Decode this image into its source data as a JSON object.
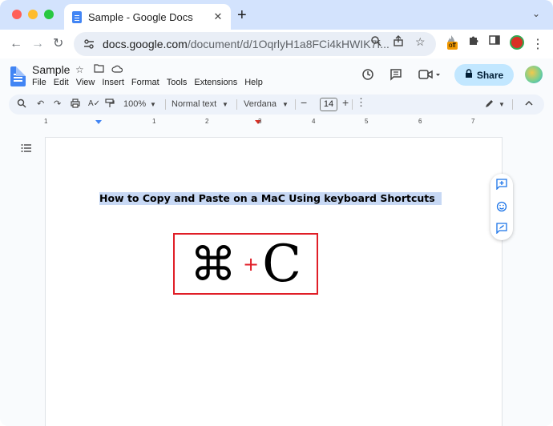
{
  "browser": {
    "tab": {
      "title": "Sample - Google Docs",
      "close": "✕"
    },
    "new_tab": "+",
    "tab_menu": "⌄",
    "nav": {
      "back": "←",
      "forward": "→",
      "reload": "↻"
    },
    "url": {
      "host": "docs.google.com",
      "path": "/document/d/1OqrlyH1a8FCi4kHWIK7f..."
    },
    "extension_badge": "off",
    "menu": "⋮"
  },
  "docs": {
    "title": "Sample",
    "menu": [
      "File",
      "Edit",
      "View",
      "Insert",
      "Format",
      "Tools",
      "Extensions",
      "Help"
    ],
    "share_label": "Share"
  },
  "format_toolbar": {
    "zoom": "100%",
    "style": "Normal text",
    "font": "Verdana",
    "font_size": "14",
    "minus": "−",
    "plus": "+"
  },
  "ruler": [
    "1",
    "1",
    "2",
    "3",
    "4",
    "5",
    "6",
    "7"
  ],
  "document": {
    "heading": "How to Copy and Paste on a MaC Using keyboard Shortcuts",
    "shortcut": {
      "modifier": "⌘",
      "plus": "+",
      "key": "C"
    }
  },
  "colors": {
    "accent": "#4285f4",
    "share_bg": "#c2e7ff",
    "highlight": "#c7d8f4",
    "box_red": "#e01e27"
  }
}
